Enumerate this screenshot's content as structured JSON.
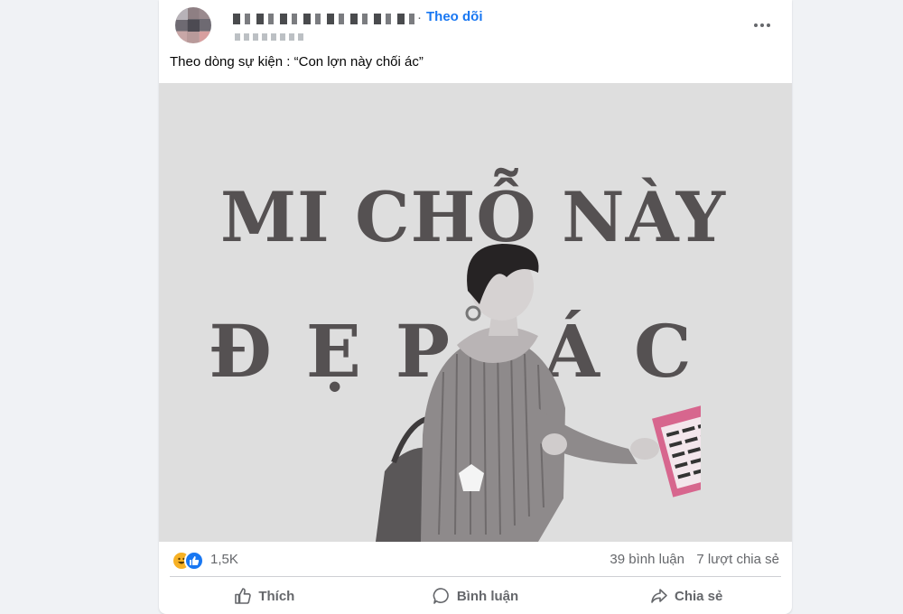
{
  "post": {
    "follow_label": "Theo dõi",
    "separator": "·",
    "caption": "Theo dòng sự kiện : “Con lợn này chối ác”",
    "image_text": {
      "line1": "MI CHỖ NÀY",
      "line2": "ĐẸP ÁC"
    },
    "reactions": {
      "icons": [
        "haha-icon",
        "like-icon"
      ],
      "count": "1,5K"
    },
    "comments": "39 bình luận",
    "shares": "7 lượt chia sẻ",
    "actions": {
      "like": "Thích",
      "comment": "Bình luận",
      "share": "Chia sẻ"
    }
  },
  "colors": {
    "page_bg": "#f0f2f5",
    "link_blue": "#1877f2",
    "photo_bg": "#dedede",
    "text_secondary": "#65676b"
  }
}
